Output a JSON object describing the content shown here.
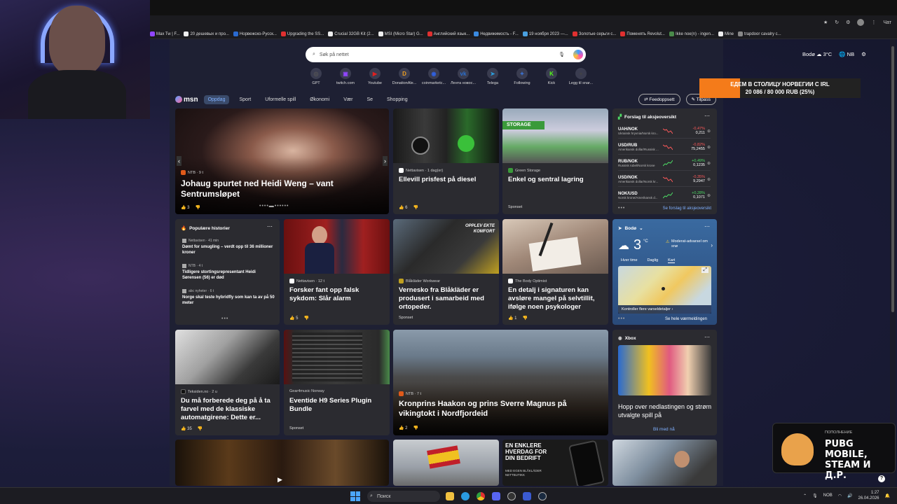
{
  "browser": {
    "tabbar_right": [
      "Чат"
    ],
    "bookmarks": [
      {
        "label": "Max Tw | F...",
        "color": "#9146ff"
      },
      {
        "label": "20 дешевых и про...",
        "color": "#eee"
      },
      {
        "label": "Норвежско-Русск...",
        "color": "#2a6acf"
      },
      {
        "label": "Upgrading the SS...",
        "color": "#e03030"
      },
      {
        "label": "Crucial 32GB Kit (2...",
        "color": "#eee"
      },
      {
        "label": "MSI (Micro Star) G...",
        "color": "#eee"
      },
      {
        "label": "Английский язык...",
        "color": "#e03030"
      },
      {
        "label": "Недвижимость - F...",
        "color": "#3a8ae0"
      },
      {
        "label": "19 ноября 2023 —...",
        "color": "#4aa0e0"
      },
      {
        "label": "Золотые серьги с...",
        "color": "#e03030"
      },
      {
        "label": "Поменять Revolut...",
        "color": "#e03030"
      },
      {
        "label": "Ikke noe(n) - ingen...",
        "color": "#4a8a4a"
      },
      {
        "label": "Mine",
        "color": "#eee"
      },
      {
        "label": "trapdoor cavalry c...",
        "color": "#888"
      }
    ]
  },
  "search": {
    "placeholder": "Søk på nettet"
  },
  "weather_top": {
    "location": "Bodø",
    "temp": "3°C",
    "lang": "NB"
  },
  "quick_links": [
    {
      "label": "GPT",
      "glyph": "◎",
      "color": "#555"
    },
    {
      "label": "twitch.com",
      "glyph": "▣",
      "color": "#9146ff"
    },
    {
      "label": "Youtube",
      "glyph": "▶",
      "color": "#e02020"
    },
    {
      "label": "DonationAle...",
      "glyph": "D",
      "color": "#f0a020"
    },
    {
      "label": "coinmarketc...",
      "glyph": "◉",
      "color": "#3060e0"
    },
    {
      "label": "Лента новос...",
      "glyph": "vk",
      "color": "#2a70d0"
    },
    {
      "label": "Telega",
      "glyph": "➤",
      "color": "#2aa0e0"
    },
    {
      "label": "Following",
      "glyph": "✦",
      "color": "#3a70d0"
    },
    {
      "label": "Kick",
      "glyph": "K",
      "color": "#53fc18"
    },
    {
      "label": "Legg til snar...",
      "glyph": "+",
      "color": "#444"
    }
  ],
  "nav": {
    "logo": "msn",
    "tabs": [
      "Oppdag",
      "Sport",
      "Uformelle spill",
      "Økonomi",
      "Vær",
      "Se",
      "Shopping"
    ],
    "feed_button": "Feedoppsett",
    "customize_button": "Tilpass"
  },
  "hero": {
    "source": "NTB · 9 t",
    "title": "Johaug spurtet ned Heidi Weng – vant Sentrumsløpet",
    "likes": "3"
  },
  "card_diesel": {
    "source": "Nettavisen · 1 dag(er)",
    "title": "Ellevill prisfest på diesel",
    "likes": "6"
  },
  "card_storage": {
    "source": "Green Storage",
    "title": "Enkel og sentral lagring",
    "sponsored": "Sponset",
    "banner": "STORAGE"
  },
  "stocks": {
    "title": "Forslag til aksjeoversikt",
    "link": "Se forslag til aksjeoversikt",
    "items": [
      {
        "sym": "UAH/NOK",
        "name": "Ukrainsk hryvnia/Norsk kro...",
        "change": "-0,47%",
        "price": "0,211",
        "color": "#ff5a5a"
      },
      {
        "sym": "USD/RUB",
        "name": "Amerikansk dollar/Russisk ...",
        "change": "-0,82%",
        "price": "75,2455",
        "color": "#ff5a5a"
      },
      {
        "sym": "RUB/NOK",
        "name": "Russisk rubel/Norsk krone",
        "change": "+0,49%",
        "price": "0,1235",
        "color": "#4cd964"
      },
      {
        "sym": "USD/NOK",
        "name": "Amerikansk dollar/Norsk kr...",
        "change": "-0,35%",
        "price": "9,2947",
        "color": "#ff5a5a"
      },
      {
        "sym": "NOK/USD",
        "name": "Norsk krone/Amerikansk d...",
        "change": "+0,28%",
        "price": "0,1071",
        "color": "#4cd964"
      }
    ]
  },
  "popular": {
    "title": "Populære historier",
    "items": [
      {
        "source": "Nettavisen · 41 min",
        "title": "Dømt for smugling – verdt opp til 36 millioner kroner"
      },
      {
        "source": "NTB · 4 t",
        "title": "Tidligere stortingsrepresentant Heidi Sørensen (56) er død"
      },
      {
        "source": "abc nyheter · 6 t",
        "title": "Norge skal teste hybridfly som kan ta av på 50 meter"
      }
    ]
  },
  "card_forsker": {
    "source": "Nettavisen · 12 t",
    "title": "Forsker fant opp falsk sykdom: Slår alarm",
    "likes": "5"
  },
  "card_vernesko": {
    "source": "Blåkläder Workwear",
    "title": "Vernesko fra Blåkläder er produsert i samarbeid med ortopeder.",
    "sponsored": "Sponset",
    "banner": "OPPLEV EKTE KOMFORT"
  },
  "card_signatur": {
    "source": "The Body Optimist",
    "title": "En detalj i signaturen kan avsløre mangel på selvtillit, ifølge noen psykologer",
    "likes": "1"
  },
  "weather_card": {
    "location": "Bodø",
    "temp": "3",
    "unit": "°C",
    "warning": "Moderat-advarsel om snø",
    "tabs": [
      "Hver time",
      "Daglig",
      "Kart"
    ],
    "map_link": "Kontroller flere varseldetaljer",
    "footer": "Se hele værmeldingen"
  },
  "card_teksiden": {
    "source": "Teksiden.no · 2 u",
    "title": "Du må forberede deg på å ta farvel med de klassiske automatgirene: Dette er...",
    "likes": "35"
  },
  "card_eventide": {
    "source": "Gear4music Norway",
    "title": "Eventide H9 Series Plugin Bundle",
    "sponsored": "Sponset"
  },
  "card_haakon": {
    "source": "NTB · 7 t",
    "title": "Kronprins Haakon og prins Sverre Magnus på vikingtokt i Nordfjordeid",
    "likes": "2"
  },
  "xbox": {
    "title": "Xbox",
    "text": "Hopp over nedlastingen og strøm utvalgte spill på",
    "link": "Bli med nå"
  },
  "blaklader_ad": {
    "text": "EN ENKLERE HVERDAG FOR DIN BEDRIFT",
    "sub": "MED EGEN BLÅKLÄDER NETTBUTIKK"
  },
  "stream_overlay": {
    "line1": "ЕДЕМ В СТОЛИЦУ НОРВЕГИИ С IRL",
    "line2": "20 086 / 80 000 RUB (25%)",
    "progress": 0.25
  },
  "promo": {
    "label": "ПОПОЛНЕНИЕ",
    "title": "PUBG MOBILE, STEAM И Д.Р."
  },
  "taskbar": {
    "search": "Поиск",
    "lang": "NOB",
    "time": "1:27",
    "date": "26.04.2026"
  }
}
